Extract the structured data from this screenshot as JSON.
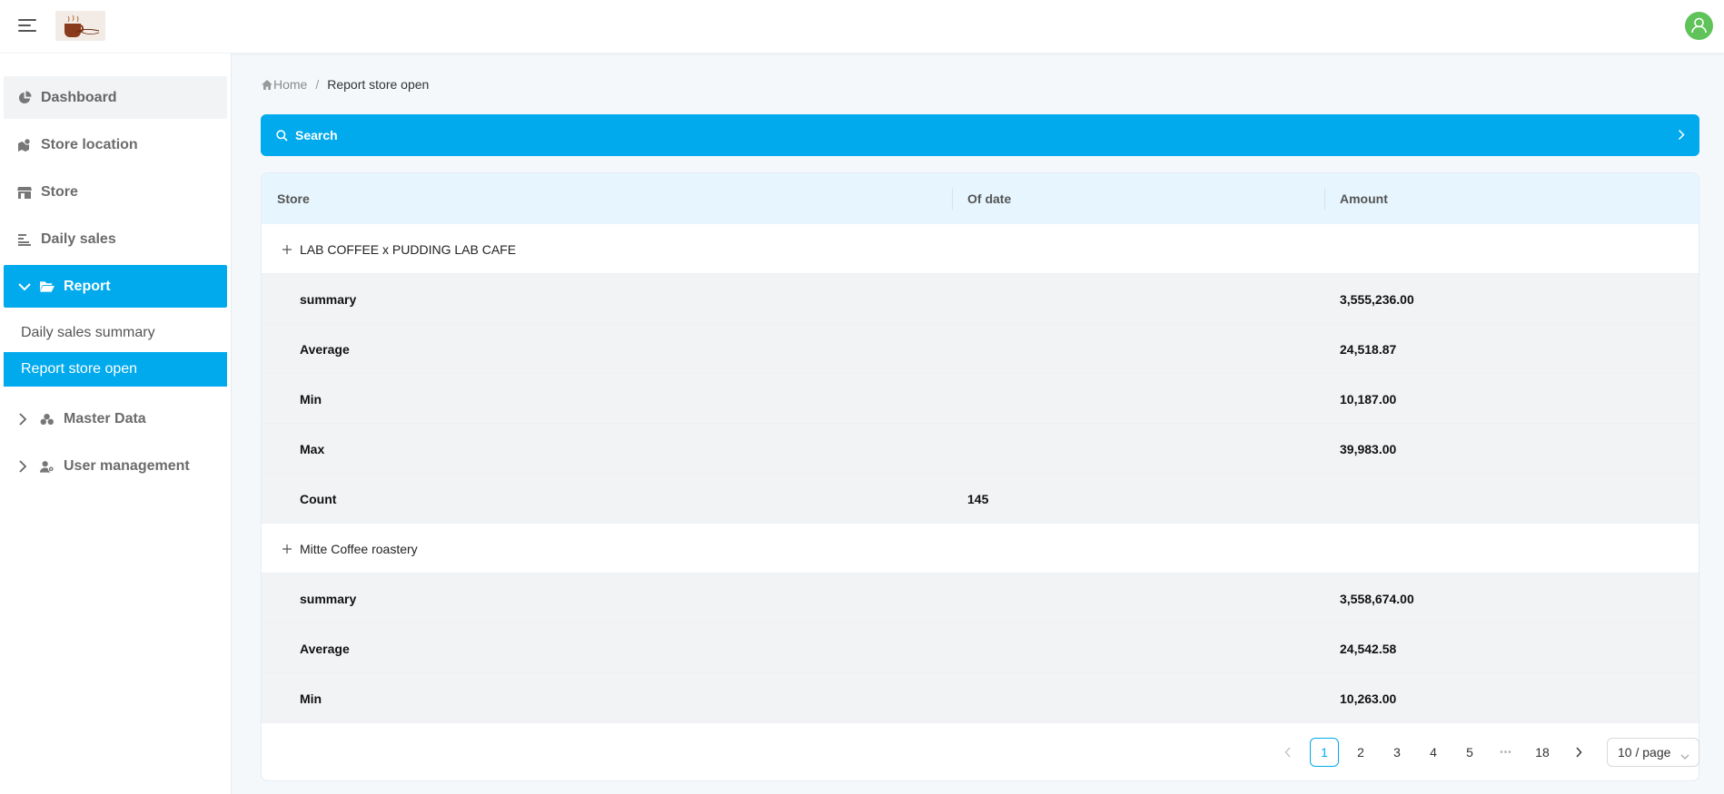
{
  "header": {
    "logo_alt": "Coffee Shop"
  },
  "sidebar": {
    "items": [
      {
        "label": "Dashboard",
        "icon": "pie-chart-icon"
      },
      {
        "label": "Store location",
        "icon": "map-location-icon"
      },
      {
        "label": "Store",
        "icon": "shop-icon"
      },
      {
        "label": "Daily sales",
        "icon": "bar-list-icon"
      },
      {
        "label": "Report",
        "icon": "folder-open-icon"
      },
      {
        "label": "Master Data",
        "icon": "coins-icon"
      },
      {
        "label": "User management",
        "icon": "user-gear-icon"
      }
    ],
    "report_children": [
      {
        "label": "Daily sales summary"
      },
      {
        "label": "Report store open"
      }
    ]
  },
  "breadcrumb": {
    "home": "Home",
    "separator": "/",
    "current": "Report store open"
  },
  "search": {
    "label": "Search"
  },
  "table": {
    "columns": [
      "Store",
      "Of date",
      "Amount"
    ],
    "groups": [
      {
        "store": "LAB COFFEE x PUDDING LAB CAFE",
        "stats": [
          {
            "label": "summary",
            "of_date": "",
            "amount": "3,555,236.00"
          },
          {
            "label": "Average",
            "of_date": "",
            "amount": "24,518.87"
          },
          {
            "label": "Min",
            "of_date": "",
            "amount": "10,187.00"
          },
          {
            "label": "Max",
            "of_date": "",
            "amount": "39,983.00"
          },
          {
            "label": "Count",
            "of_date": "145",
            "amount": ""
          }
        ]
      },
      {
        "store": "Mitte Coffee roastery",
        "stats": [
          {
            "label": "summary",
            "of_date": "",
            "amount": "3,558,674.00"
          },
          {
            "label": "Average",
            "of_date": "",
            "amount": "24,542.58"
          },
          {
            "label": "Min",
            "of_date": "",
            "amount": "10,263.00"
          }
        ]
      }
    ]
  },
  "pagination": {
    "pages": [
      "1",
      "2",
      "3",
      "4",
      "5"
    ],
    "ellipsis": "•••",
    "last": "18",
    "current": "1",
    "page_size": "10 / page"
  },
  "colors": {
    "accent": "#00aaed",
    "avatar": "#5fc35a"
  }
}
